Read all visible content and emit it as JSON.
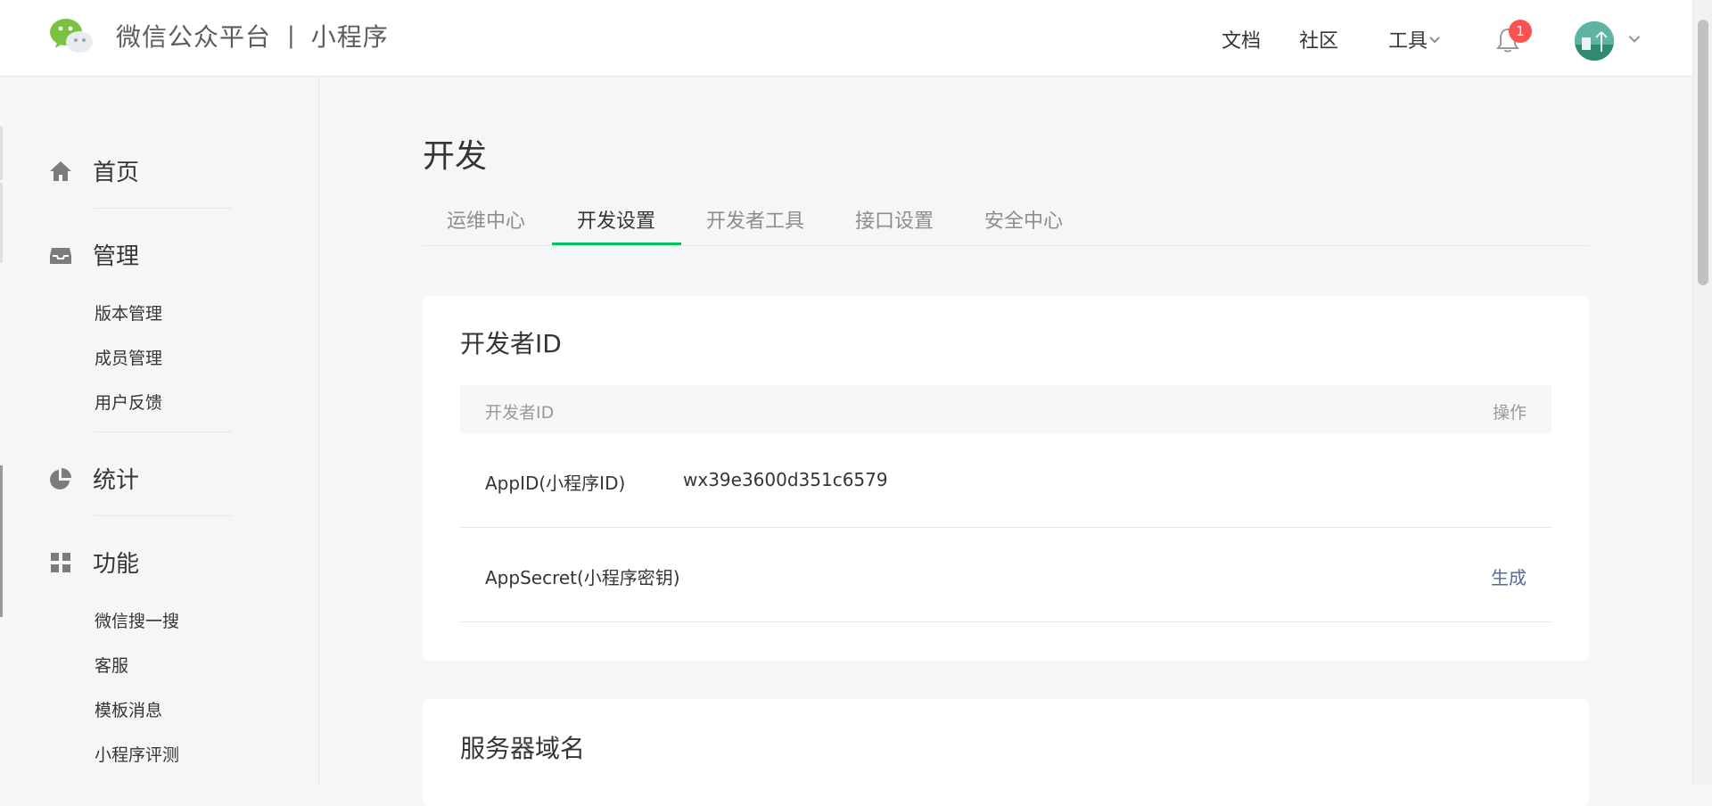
{
  "header": {
    "brand_name": "微信公众平台",
    "brand_sep": "|",
    "brand_product": "小程序",
    "nav": {
      "docs": "文档",
      "community": "社区",
      "tools": "工具"
    },
    "notification_count": "1"
  },
  "sidebar": {
    "home": "首页",
    "manage": "管理",
    "manage_items": [
      "版本管理",
      "成员管理",
      "用户反馈"
    ],
    "stats": "统计",
    "features": "功能",
    "feature_items": [
      "微信搜一搜",
      "客服",
      "模板消息",
      "小程序评测"
    ]
  },
  "main": {
    "title": "开发",
    "tabs": [
      "运维中心",
      "开发设置",
      "开发者工具",
      "接口设置",
      "安全中心"
    ],
    "active_tab": "开发设置",
    "developer_id_card": {
      "title": "开发者ID",
      "table_header": {
        "name": "开发者ID",
        "action": "操作"
      },
      "rows": [
        {
          "label": "AppID(小程序ID)",
          "value": "wx39e3600d351c6579",
          "action": ""
        },
        {
          "label": "AppSecret(小程序密钥)",
          "value": "",
          "action": "生成"
        }
      ]
    },
    "server_domain_card": {
      "title": "服务器域名"
    }
  },
  "colors": {
    "accent": "#07c160",
    "link": "#576b95",
    "badge": "#fa5151"
  }
}
